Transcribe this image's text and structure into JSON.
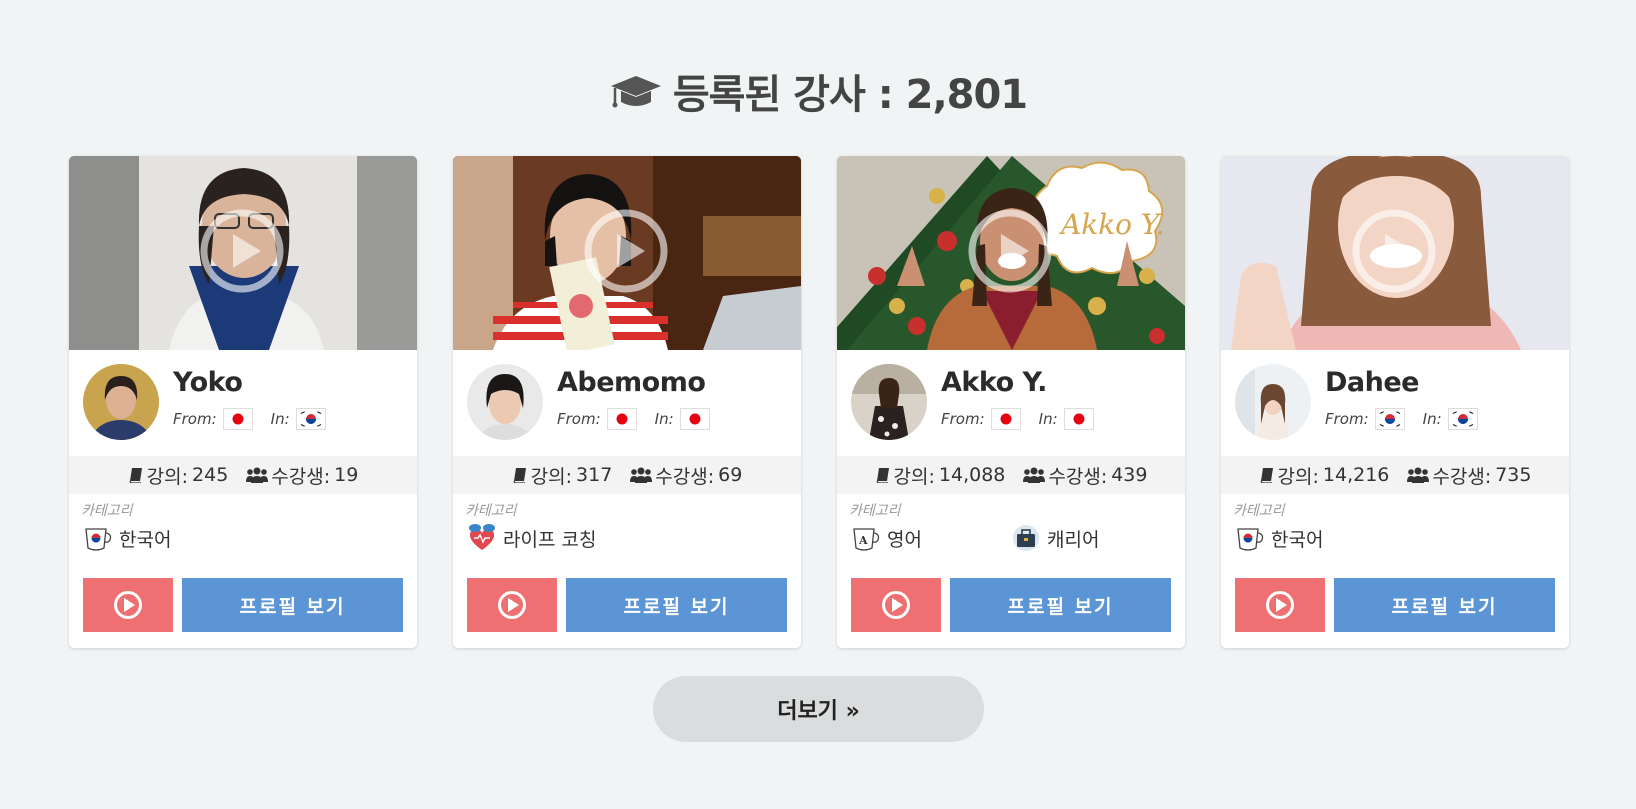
{
  "header": {
    "title_text": "등록된 강사 : 2,801",
    "icon": "graduation-cap-icon"
  },
  "labels": {
    "from": "From:",
    "in": "In:",
    "lessons": "강의:",
    "students": "수강생:",
    "category": "카테고리",
    "profile_button": "프로필 보기"
  },
  "teachers": [
    {
      "name": "Yoko",
      "from_flag": "japan-flag",
      "in_flag": "korea-flag",
      "lessons": "245",
      "students": "19",
      "categories": [
        {
          "label": "한국어",
          "icon": "coffee-cup-korea-icon"
        }
      ]
    },
    {
      "name": "Abemomo",
      "from_flag": "japan-flag",
      "in_flag": "japan-flag",
      "lessons": "317",
      "students": "69",
      "categories": [
        {
          "label": "라이프 코칭",
          "icon": "heart-chat-icon"
        }
      ]
    },
    {
      "name": "Akko Y.",
      "from_flag": "japan-flag",
      "in_flag": "japan-flag",
      "lessons": "14,088",
      "students": "439",
      "categories": [
        {
          "label": "영어",
          "icon": "coffee-cup-english-icon"
        },
        {
          "label": "캐리어",
          "icon": "briefcase-icon"
        }
      ]
    },
    {
      "name": "Dahee",
      "from_flag": "korea-flag",
      "in_flag": "korea-flag",
      "lessons": "14,216",
      "students": "735",
      "categories": [
        {
          "label": "한국어",
          "icon": "coffee-cup-korea-icon"
        }
      ]
    }
  ],
  "more_button": {
    "label": "더보기 »"
  },
  "colors": {
    "background": "#f1f4f5",
    "video_button": "#ef7072",
    "profile_button": "#5b95d6",
    "more_button": "#dadcde"
  }
}
